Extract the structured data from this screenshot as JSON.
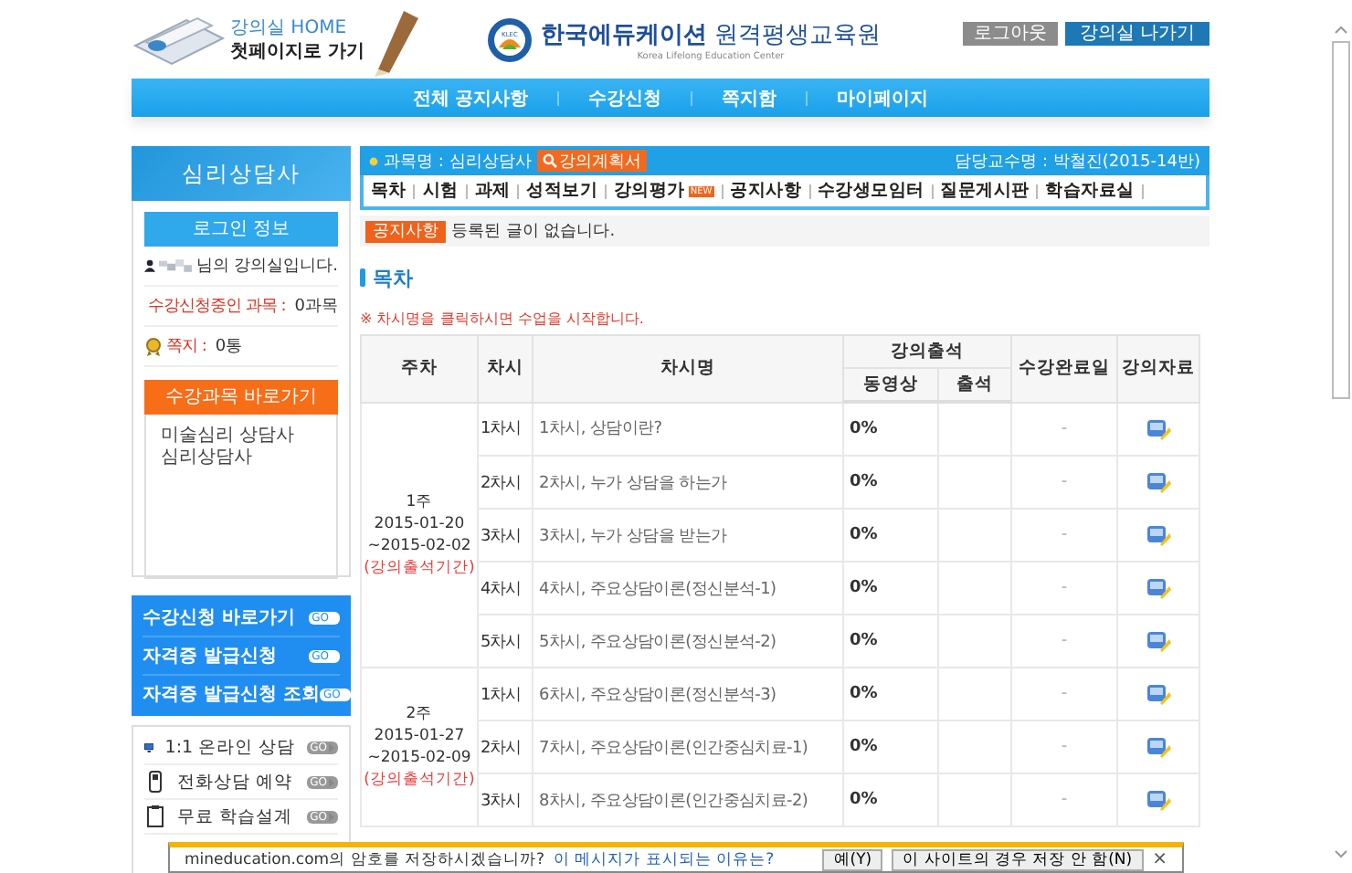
{
  "header": {
    "home_title": "강의실 HOME",
    "home_subtitle": "첫페이지로 가기",
    "logo_mark": "KLEC",
    "site_name_1": "한국에듀케이션",
    "site_name_2": "원격평생교육원",
    "site_name_en": "Korea Lifelong Education Center",
    "buttons": [
      {
        "label": "로그아웃",
        "kind": "gray"
      },
      {
        "label": "강의실 나가기",
        "kind": "blue"
      }
    ]
  },
  "nav": [
    "전체 공지사항",
    "수강신청",
    "쪽지함",
    "마이페이지"
  ],
  "sidebar": {
    "title": "심리상담사",
    "login_heading": "로그인 정보",
    "welcome": "님의 강의실입니다.",
    "enrolled_label": "수강신청중인 과목 :",
    "enrolled_value": "0과목",
    "notes_label": "쪽지 :",
    "notes_value": "0통",
    "courses_heading": "수강과목 바로가기",
    "courses": [
      "미술심리 상담사",
      "심리상담사"
    ],
    "blue_links": [
      {
        "label": "수강신청 바로가기",
        "badge": "GO"
      },
      {
        "label": "자격증 발급신청",
        "badge": "GO"
      },
      {
        "label": "자격증 발급신청 조회",
        "badge": "GO"
      }
    ],
    "services": [
      {
        "label": "1:1 온라인 상담",
        "badge": "GO",
        "kind": "monitor"
      },
      {
        "label": "전화상담 예약",
        "badge": "GO",
        "kind": "phone"
      },
      {
        "label": "무료 학습설계",
        "badge": "GO",
        "kind": "clipboard"
      }
    ]
  },
  "course_bar": {
    "label": "과목명 : 심리상담사",
    "plan_button": "강의계획서",
    "professor": "담당교수명 : 박철진(2015-14반)"
  },
  "tabs": [
    {
      "label": "목차"
    },
    {
      "label": "시험"
    },
    {
      "label": "과제"
    },
    {
      "label": "성적보기"
    },
    {
      "label": "강의평가",
      "badge": "NEW"
    },
    {
      "label": "공지사항"
    },
    {
      "label": "수강생모임터"
    },
    {
      "label": "질문게시판"
    },
    {
      "label": "학습자료실"
    }
  ],
  "notice": {
    "tag": "공지사항",
    "text": "등록된 글이 없습니다."
  },
  "section_title": "목차",
  "note": "※ 차시명을 클릭하시면 수업을 시작합니다.",
  "table": {
    "columns": {
      "week": "주차",
      "session": "차시",
      "title": "차시명",
      "attendance": "강의출석",
      "video": "동영상",
      "present": "출석",
      "completed": "수강완료일",
      "material": "강의자료"
    },
    "weeks": [
      {
        "week": "1주",
        "start": "2015-01-20",
        "end": "~2015-02-02",
        "period": "(강의출석기간)",
        "lessons": [
          {
            "session": "1차시",
            "title": "1차시, 상담이란?",
            "video": "0%",
            "completed": "-"
          },
          {
            "session": "2차시",
            "title": "2차시, 누가 상담을 하는가",
            "video": "0%",
            "completed": "-"
          },
          {
            "session": "3차시",
            "title": "3차시, 누가 상담을 받는가",
            "video": "0%",
            "completed": "-"
          },
          {
            "session": "4차시",
            "title": "4차시, 주요상담이론(정신분석-1)",
            "video": "0%",
            "completed": "-"
          },
          {
            "session": "5차시",
            "title": "5차시, 주요상담이론(정신분석-2)",
            "video": "0%",
            "completed": "-"
          }
        ]
      },
      {
        "week": "2주",
        "start": "2015-01-27",
        "end": "~2015-02-09",
        "period": "(강의출석기간)",
        "lessons": [
          {
            "session": "1차시",
            "title": "6차시, 주요상담이론(정신분석-3)",
            "video": "0%",
            "completed": "-"
          },
          {
            "session": "2차시",
            "title": "7차시, 주요상담이론(인간중심치료-1)",
            "video": "0%",
            "completed": "-"
          },
          {
            "session": "3차시",
            "title": "8차시, 주요상담이론(인간중심치료-2)",
            "video": "0%",
            "completed": "-"
          }
        ]
      }
    ]
  },
  "save_prompt": {
    "text": "mineducation.com의 암호를 저장하시겠습니까?",
    "link": "이 메시지가 표시되는 이유는?",
    "buttons": [
      "예(Y)",
      "이 사이트의 경우 저장 안 함(N)"
    ],
    "close": "×"
  }
}
